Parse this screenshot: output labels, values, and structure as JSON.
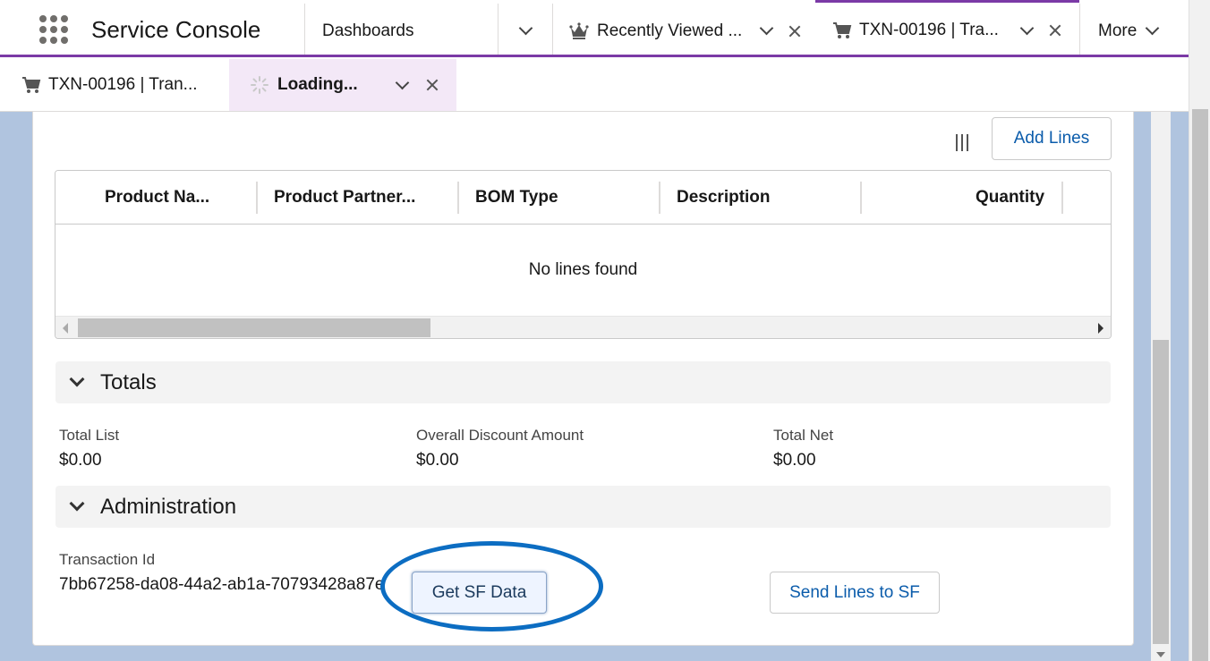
{
  "header": {
    "app_name": "Service Console",
    "tabs": [
      {
        "label": "Dashboards"
      },
      {
        "label": "Recently Viewed ..."
      },
      {
        "label": "TXN-00196 | Tra..."
      }
    ],
    "more_label": "More"
  },
  "subtabs": [
    {
      "label": "TXN-00196 | Tran..."
    },
    {
      "label": "Loading..."
    }
  ],
  "lines": {
    "add_button": "Add Lines",
    "columns": [
      "Product Na...",
      "Product Partner...",
      "BOM Type",
      "Description",
      "Quantity"
    ],
    "empty_message": "No lines found"
  },
  "totals": {
    "title": "Totals",
    "fields": [
      {
        "label": "Total List",
        "value": "$0.00"
      },
      {
        "label": "Overall Discount Amount",
        "value": "$0.00"
      },
      {
        "label": "Total Net",
        "value": "$0.00"
      }
    ]
  },
  "administration": {
    "title": "Administration",
    "transaction_id_label": "Transaction Id",
    "transaction_id_value": "7bb67258-da08-44a2-ab1a-70793428a87e",
    "get_sf_button": "Get SF Data",
    "send_lines_button": "Send Lines to SF"
  },
  "colors": {
    "accent": "#7b3aa6",
    "link": "#0b5cab",
    "highlight": "#0c6dc2",
    "background": "#b0c4df"
  }
}
